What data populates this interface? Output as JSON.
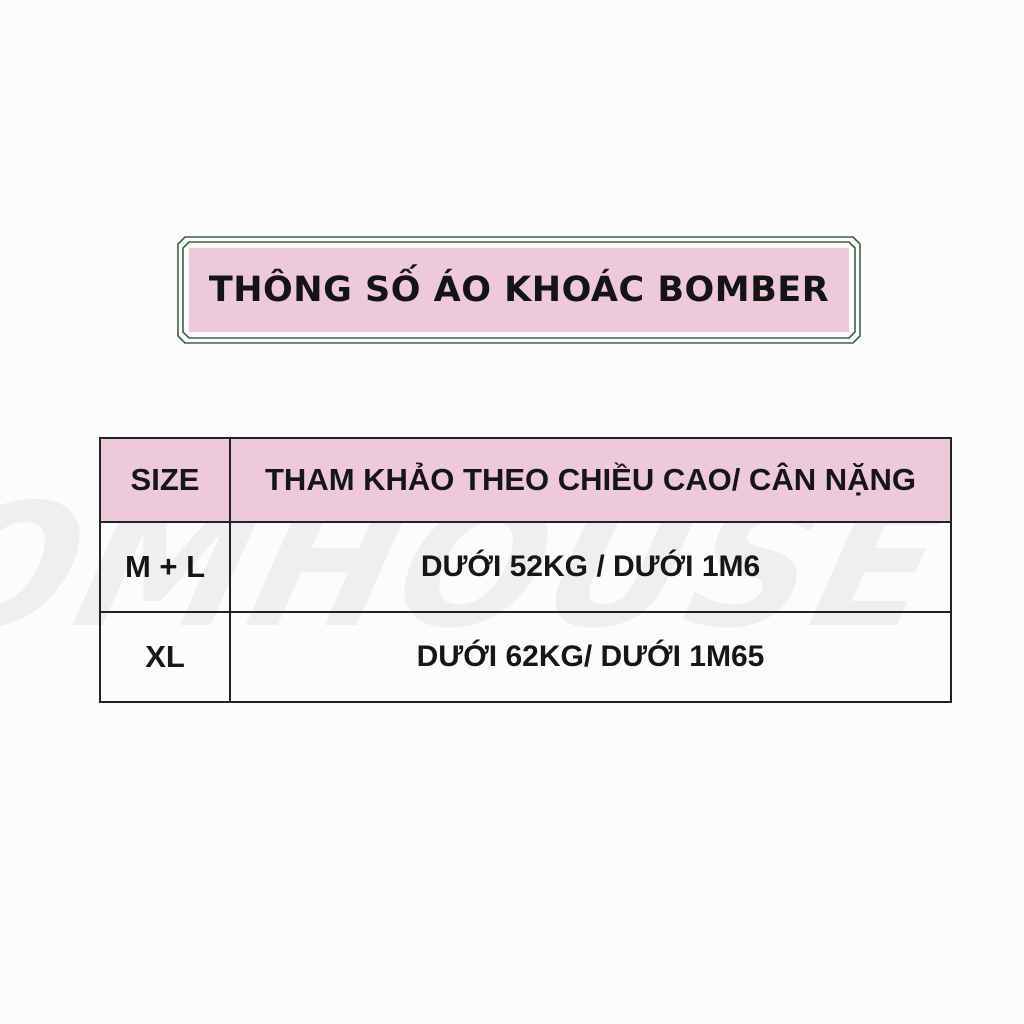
{
  "title": "THÔNG SỐ ÁO KHOÁC BOMBER",
  "watermark": "BOMHOUSE",
  "table": {
    "headers": [
      "SIZE",
      "THAM KHẢO THEO CHIỀU CAO/ CÂN NẶNG"
    ],
    "rows": [
      {
        "size": "M + L",
        "reference": "DƯỚI 52KG / DƯỚI 1M6"
      },
      {
        "size": "XL",
        "reference": "DƯỚI 62KG/ DƯỚI 1M65"
      }
    ]
  },
  "colors": {
    "header_fill": "#eec9db",
    "frame_stroke": "#3e5e46",
    "border": "#222222",
    "background": "#fdfcfc"
  }
}
